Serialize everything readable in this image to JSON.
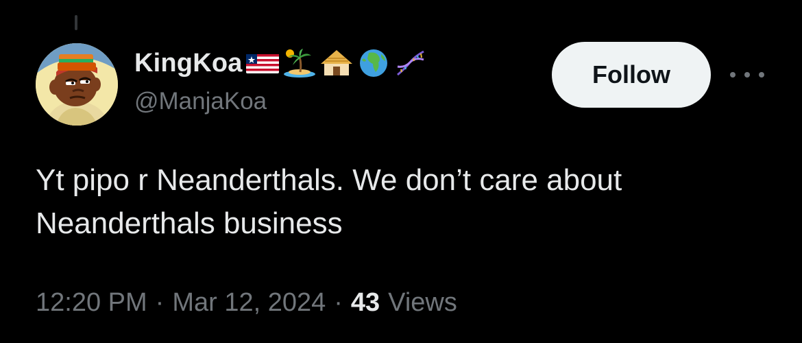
{
  "user": {
    "display_name": "KingKoa",
    "handle": "@ManjaKoa",
    "emojis": [
      "flag-liberia-icon",
      "desert-island-icon",
      "hut-icon",
      "globe-africa-icon",
      "dna-icon"
    ]
  },
  "follow_label": "Follow",
  "tweet": {
    "text": "Yt pipo r Neanderthals. We don’t care about Neanderthals business"
  },
  "meta": {
    "time": "12:20 PM",
    "separator": "·",
    "date": "Mar 12, 2024",
    "views_count": "43",
    "views_label": "Views"
  },
  "colors": {
    "background": "#000000",
    "primary_text": "#e7e9ea",
    "secondary_text": "#71767b",
    "follow_button_bg": "#eff3f4",
    "follow_button_text": "#0f1419"
  }
}
